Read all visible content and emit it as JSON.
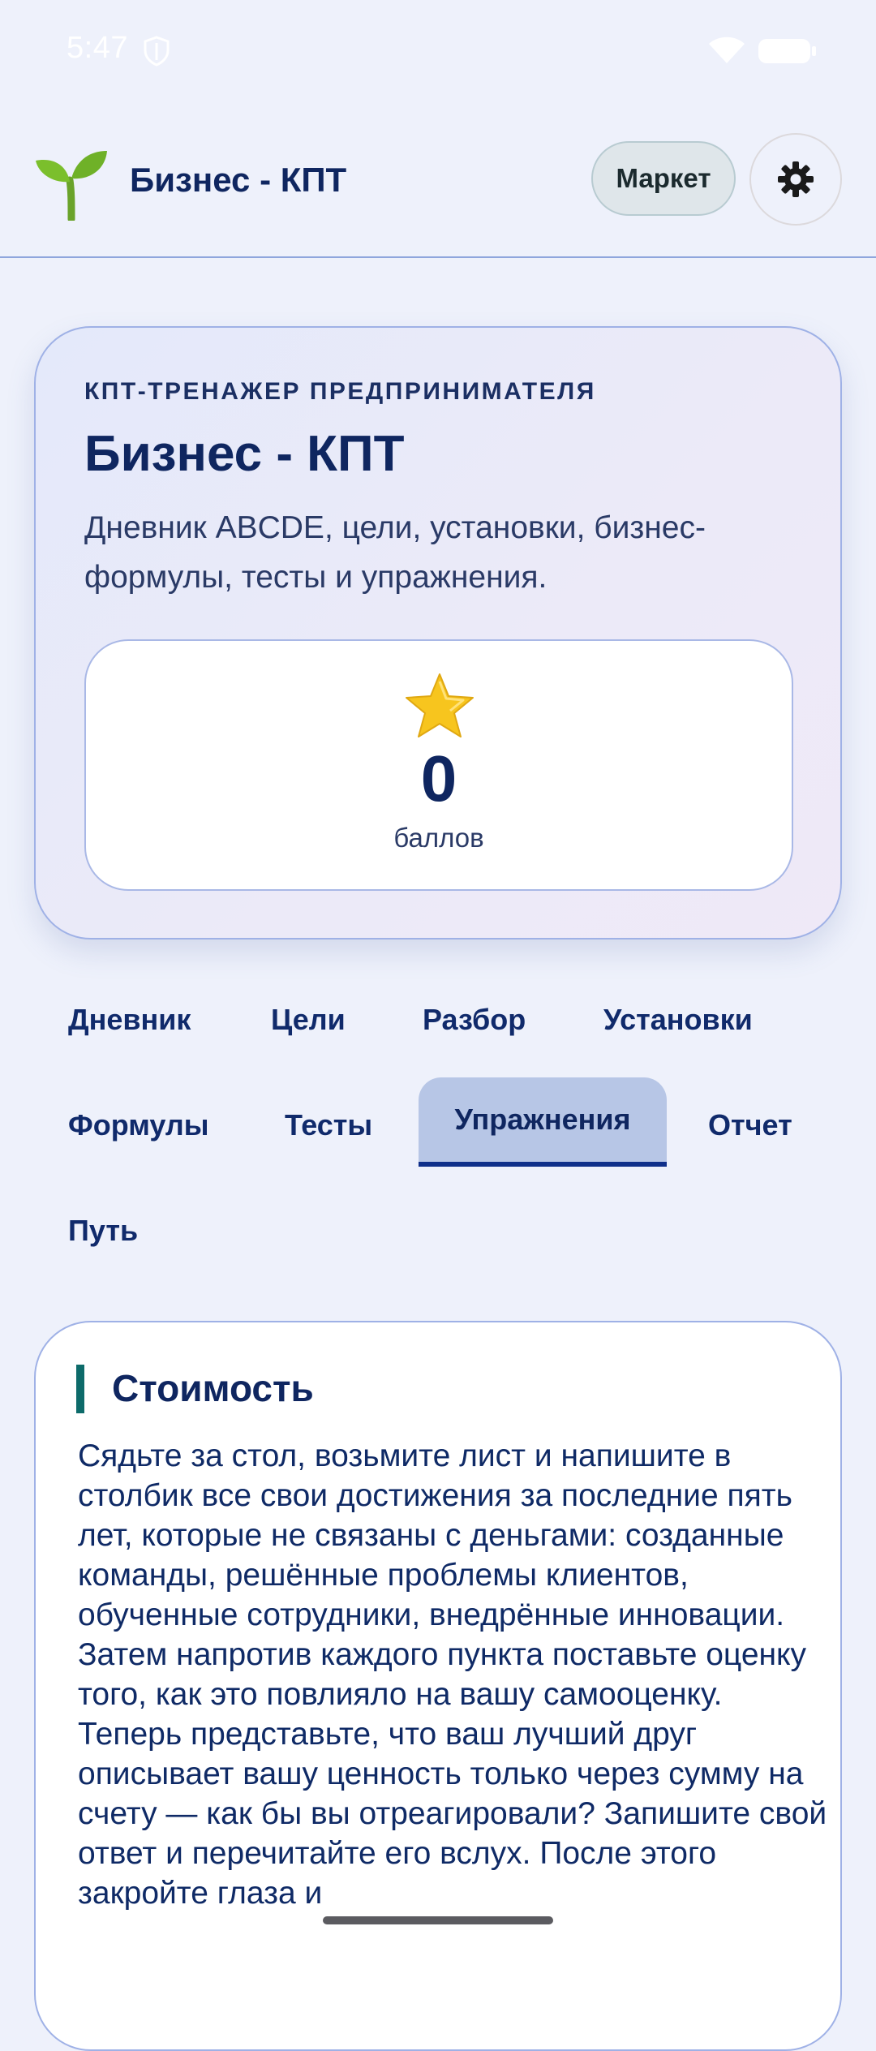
{
  "status_bar": {
    "time": "5:47"
  },
  "header": {
    "app_title": "Бизнес - КПТ",
    "market_label": "Маркет",
    "logo_icon": "sprout-icon",
    "settings_icon": "gear-icon"
  },
  "hero": {
    "kicker": "КПТ-ТРЕНАЖЕР ПРЕДПРИНИМАТЕЛЯ",
    "title": "Бизнес - КПТ",
    "description": "Дневник ABCDE, цели, установки, бизнес-формулы, тесты и упражнения.",
    "score": {
      "icon": "star-icon",
      "value": "0",
      "label": "баллов"
    }
  },
  "tabs": [
    {
      "label": "Дневник",
      "active": false
    },
    {
      "label": "Цели",
      "active": false
    },
    {
      "label": "Разбор",
      "active": false
    },
    {
      "label": "Установки",
      "active": false
    },
    {
      "label": "Формулы",
      "active": false
    },
    {
      "label": "Тесты",
      "active": false
    },
    {
      "label": "Упражнения",
      "active": true
    },
    {
      "label": "Отчет",
      "active": false
    },
    {
      "label": "Путь",
      "active": false
    }
  ],
  "exercise": {
    "title": "Стоимость",
    "text": "Сядьте за стол, возьмите лист и напишите в столбик все свои достижения за последние пять лет, которые не связаны с деньгами: созданные команды, решённые проблемы клиентов, обученные сотрудники, внедрённые инновации. Затем напротив каждого пункта поставьте оценку того, как это повлияло на вашу самооценку. Теперь представьте, что ваш лучший друг описывает вашу ценность только через сумму на счету — как бы вы отреагировали? Запишите свой ответ и перечитайте его вслух. После этого закройте глаза и"
  },
  "colors": {
    "background": "#eef1fb",
    "primary_text": "#0f2660",
    "active_tab_bg": "#b7c6e6",
    "active_tab_underline": "#0f2f8a",
    "accent_bar": "#0d6b6a",
    "market_button_bg": "#dfe6ea"
  }
}
